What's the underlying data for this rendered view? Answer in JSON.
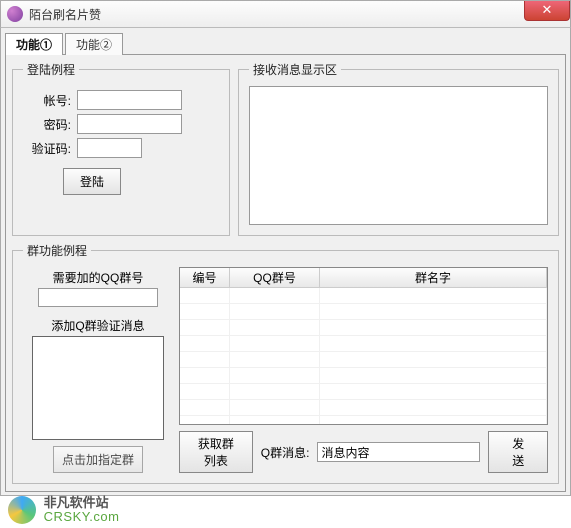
{
  "window": {
    "title": "陌台刷名片赞"
  },
  "tabs": [
    {
      "label": "功能①"
    },
    {
      "label": "功能②"
    }
  ],
  "login": {
    "legend": "登陆例程",
    "account_label": "帐号:",
    "password_label": "密码:",
    "captcha_label": "验证码:",
    "button": "登陆",
    "account_value": "",
    "password_value": "",
    "captcha_value": ""
  },
  "recv": {
    "legend": "接收消息显示区",
    "content": ""
  },
  "group": {
    "legend": "群功能例程",
    "need_group_label": "需要加的QQ群号",
    "need_group_value": "",
    "verify_label": "添加Q群验证消息",
    "verify_value": "",
    "add_specific_button": "点击加指定群",
    "get_list_button": "获取群列表",
    "msg_label": "Q群消息:",
    "msg_value": "消息内容",
    "send_button": "发送",
    "columns": [
      "编号",
      "QQ群号",
      "群名字"
    ],
    "rows": []
  },
  "watermark": {
    "cn": "非凡软件站",
    "en": "CRSKY.com"
  }
}
